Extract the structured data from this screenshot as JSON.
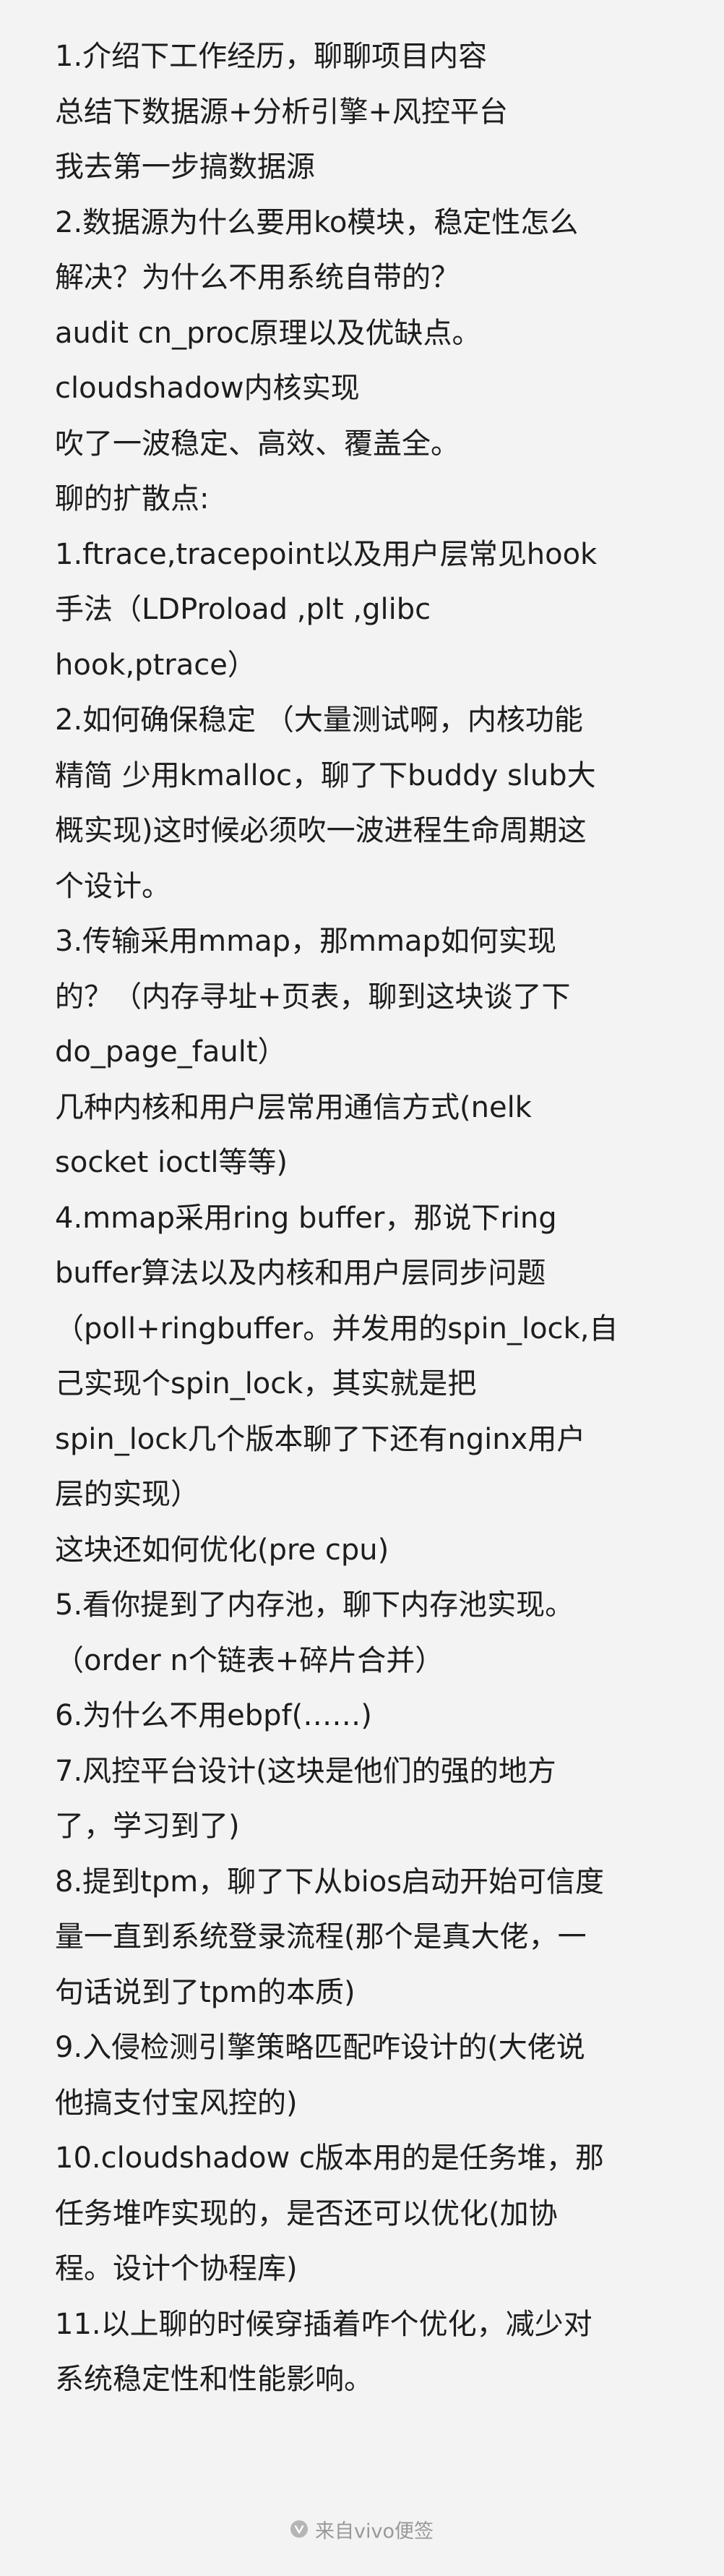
{
  "note": {
    "lines": [
      "1.介绍下工作经历，聊聊项目内容",
      "总结下数据源+分析引擎+风控平台",
      "我去第一步搞数据源",
      "2.数据源为什么要用ko模块，稳定性怎么",
      "解决？为什么不用系统自带的？",
      " audit cn_proc原理以及优缺点。",
      "cloudshadow内核实现",
      "吹了一波稳定、高效、覆盖全。",
      "聊的扩散点:",
      "1.ftrace,tracepoint以及用户层常见hook",
      "手法（LDProload ,plt ,glibc",
      "hook,ptrace）",
      "2.如何确保稳定 （大量测试啊，内核功能",
      "精简 少用kmalloc，聊了下buddy slub大",
      "概实现)这时候必须吹一波进程生命周期这",
      "个设计。",
      "3.传输采用mmap，那mmap如何实现",
      "的？（内存寻址+页表，聊到这块谈了下",
      "do_page_fault）",
      "几种内核和用户层常用通信方式(nelk",
      "socket ioctl等等)",
      "4.mmap采用ring buffer，那说下ring",
      "buffer算法以及内核和用户层同步问题",
      "（poll+ringbuffer。并发用的spin_lock,自",
      "己实现个spin_lock，其实就是把",
      "spin_lock几个版本聊了下还有nginx用户",
      "层的实现）",
      "这块还如何优化(pre cpu)",
      "5.看你提到了内存池，聊下内存池实现。",
      "（order n个链表+碎片合并）",
      "6.为什么不用ebpf(……)",
      "7.风控平台设计(这块是他们的强的地方",
      "了，学习到了)",
      "8.提到tpm，聊了下从bios启动开始可信度",
      "量一直到系统登录流程(那个是真大佬，一",
      "句话说到了tpm的本质)",
      "9.入侵检测引擎策略匹配咋设计的(大佬说",
      "他搞支付宝风控的)",
      "10.cloudshadow c版本用的是任务堆，那",
      "任务堆咋实现的，是否还可以优化(加协",
      "程。设计个协程库)",
      "11.以上聊的时候穿插着咋个优化，减少对",
      "系统稳定性和性能影响。"
    ]
  },
  "footer": {
    "label": "来自vivo便签",
    "icon": "vivo-logo-icon",
    "icon_color": "#b5b5b5",
    "text_color": "#999999"
  },
  "colors": {
    "background": "#f3f3f3",
    "text": "#1d1d1d"
  }
}
